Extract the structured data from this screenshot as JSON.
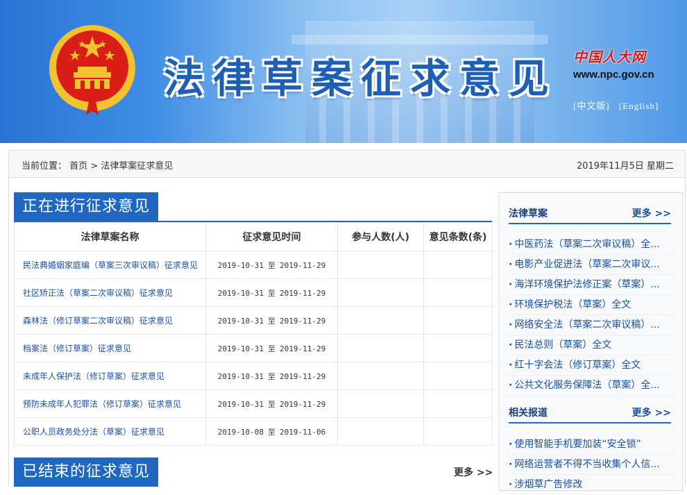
{
  "header": {
    "title": "法律草案征求意见",
    "brand_cn": "中国人大网",
    "brand_url": "www.npc.gov.cn",
    "lang_cn": "[中文版]",
    "lang_en": "[English]"
  },
  "breadcrumb": {
    "prefix": "当前位置：",
    "home": "首页",
    "separator": ">",
    "current": "法律草案征求意见",
    "date": "2019年11月5日 星期二"
  },
  "ongoing": {
    "title": "正在进行征求意见",
    "columns": [
      "法律草案名称",
      "征求意见时间",
      "参与人数(人)",
      "意见条数(条)"
    ],
    "to_label": "至",
    "rows": [
      {
        "name": "民法典婚姻家庭编（草案三次审议稿）征求意见",
        "start": "2019-10-31",
        "end": "2019-11-29"
      },
      {
        "name": "社区矫正法（草案二次审议稿）征求意见",
        "start": "2019-10-31",
        "end": "2019-11-29"
      },
      {
        "name": "森林法（修订草案二次审议稿）征求意见",
        "start": "2019-10-31",
        "end": "2019-11-29"
      },
      {
        "name": "档案法（修订草案）征求意见",
        "start": "2019-10-31",
        "end": "2019-11-29"
      },
      {
        "name": "未成年人保护法（修订草案）征求意见",
        "start": "2019-10-31",
        "end": "2019-11-29"
      },
      {
        "name": "预防未成年人犯罪法（修订草案）征求意见",
        "start": "2019-10-31",
        "end": "2019-11-29"
      },
      {
        "name": "公职人员政务处分法（草案）征求意见",
        "start": "2019-10-08",
        "end": "2019-11-06"
      }
    ]
  },
  "ended": {
    "title": "已结束的征求意见",
    "more": "更多 >>"
  },
  "sidebar": {
    "drafts": {
      "title": "法律草案",
      "more": "更多 >>",
      "items": [
        "中医药法（草案二次审议稿）全...",
        "电影产业促进法（草案二次审议...",
        "海洋环境保护法修正案（草案）...",
        "环境保护税法（草案）全文",
        "网络安全法（草案二次审议稿）...",
        "民法总则（草案）全文",
        "红十字会法（修订草案）全文",
        "公共文化服务保障法（草案）全..."
      ]
    },
    "reports": {
      "title": "相关报道",
      "more": "更多 >>",
      "items": [
        "使用智能手机要加装“安全锁”",
        "网络运营者不得不当收集个人信...",
        "涉烟草广告修改"
      ]
    }
  },
  "colors": {
    "accent_blue": "#1f67c0",
    "link_blue": "#1b4f9c",
    "emblem_red": "#d91e18",
    "emblem_gold": "#f2c230"
  }
}
